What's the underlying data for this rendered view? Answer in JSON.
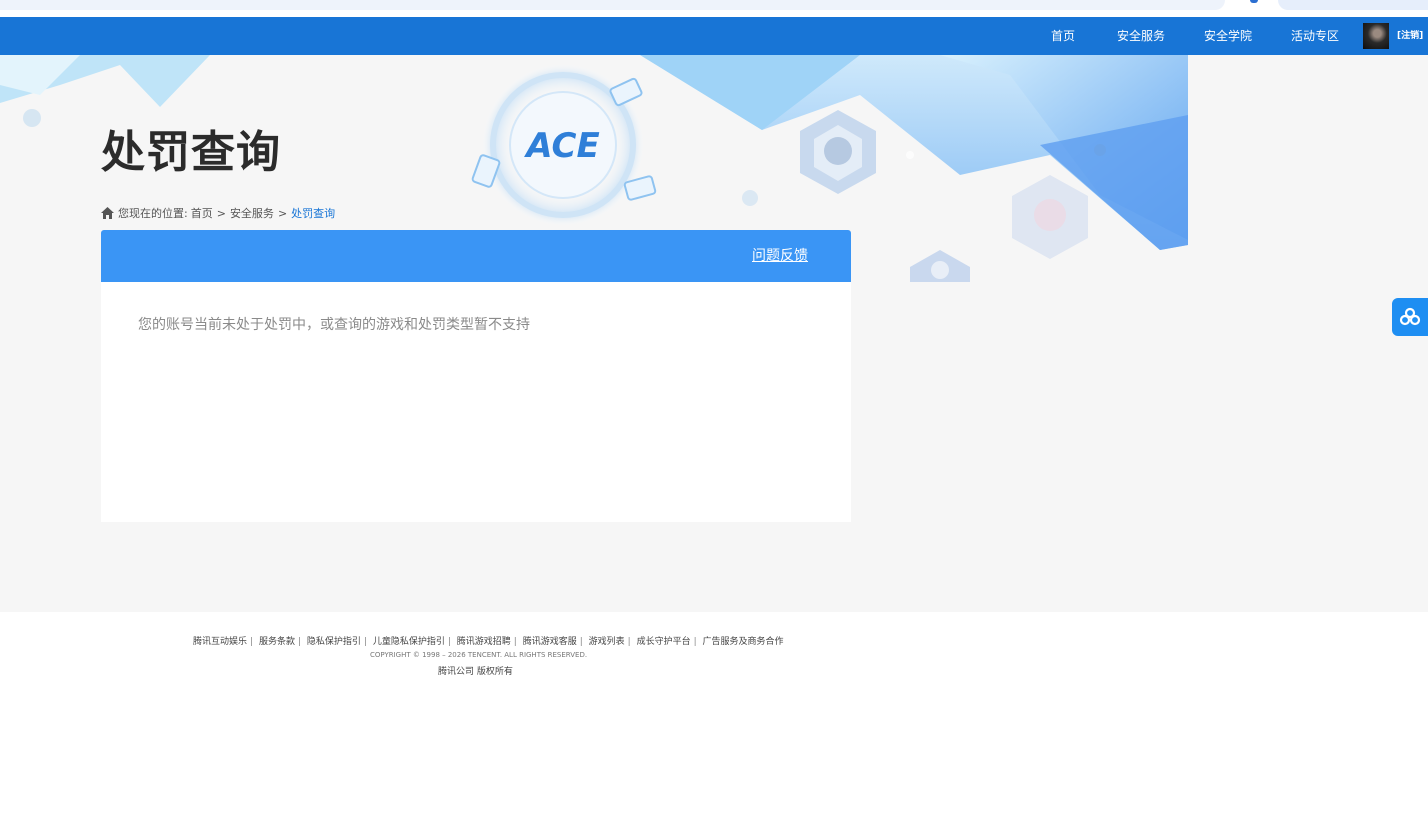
{
  "nav": {
    "items": [
      "首页",
      "安全服务",
      "安全学院",
      "活动专区"
    ],
    "logout_label": "[注销]"
  },
  "page": {
    "title": "处罚查询",
    "logo_text": "ACE"
  },
  "breadcrumb": {
    "prefix": "您现在的位置:",
    "items": [
      "首页",
      "安全服务"
    ],
    "current": "处罚查询",
    "separator": ">"
  },
  "card": {
    "feedback_label": "问题反馈",
    "message": "您的账号当前未处于处罚中，或查询的游戏和处罚类型暂不支持"
  },
  "footer": {
    "links": [
      "腾讯互动娱乐",
      "服务条款",
      "隐私保护指引",
      "儿童隐私保护指引",
      "腾讯游戏招聘",
      "腾讯游戏客服",
      "游戏列表",
      "成长守护平台",
      "广告服务及商务合作"
    ],
    "copyright": "COPYRIGHT © 1998 – 2026 TENCENT. ALL RIGHTS RESERVED.",
    "rights": "腾讯公司 版权所有"
  },
  "colors": {
    "nav_bg": "#1875d6",
    "card_head": "#3a95f5",
    "page_bg": "#f6f6f6",
    "accent": "#1875d6"
  },
  "icons": {
    "home": "home-icon",
    "float": "cloud-share-icon"
  }
}
